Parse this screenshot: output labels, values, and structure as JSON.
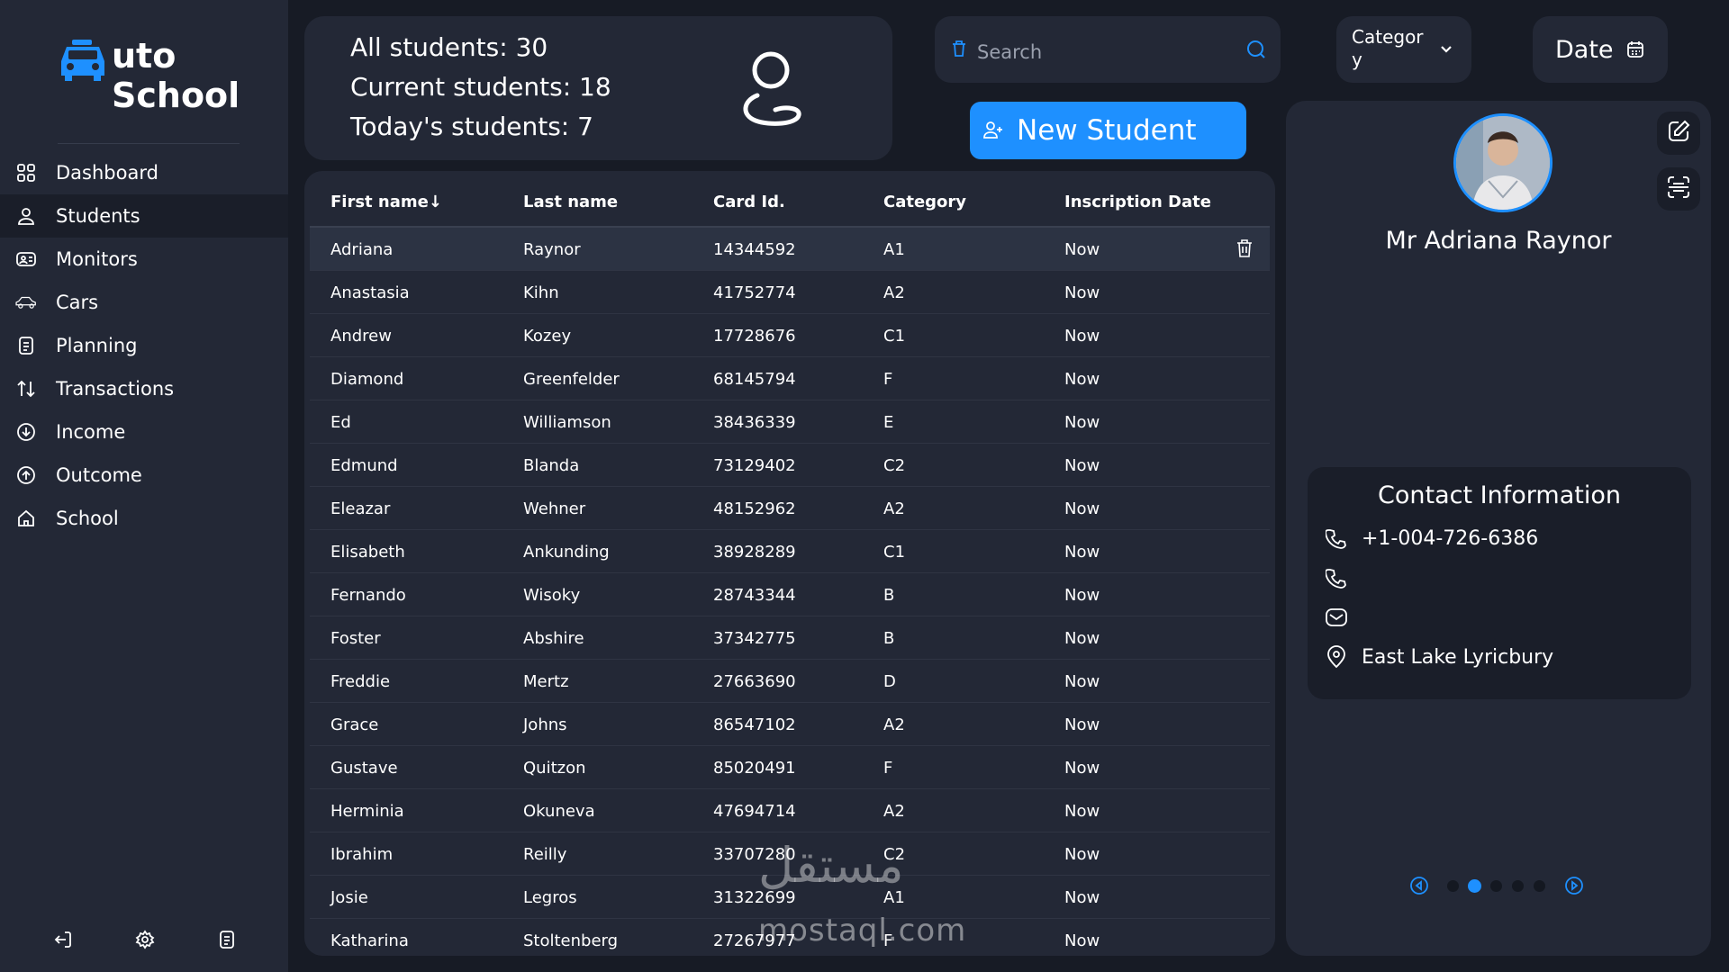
{
  "brand": {
    "line1": "uto",
    "line2": "School",
    "accent": "#1e90ff"
  },
  "sidebar": {
    "items": [
      {
        "label": "Dashboard",
        "icon": "grid-icon"
      },
      {
        "label": "Students",
        "icon": "user-icon",
        "active": true
      },
      {
        "label": "Monitors",
        "icon": "monitor-id-icon"
      },
      {
        "label": "Cars",
        "icon": "car-icon"
      },
      {
        "label": "Planning",
        "icon": "planning-icon"
      },
      {
        "label": "Transactions",
        "icon": "transactions-icon"
      },
      {
        "label": "Income",
        "icon": "income-icon"
      },
      {
        "label": "Outcome",
        "icon": "outcome-icon"
      },
      {
        "label": "School",
        "icon": "home-icon"
      }
    ],
    "bottom": [
      "logout-icon",
      "settings-icon",
      "notes-icon"
    ]
  },
  "stats": {
    "all": "All students: 30",
    "current": "Current students: 18",
    "today": "Today's students: 7"
  },
  "search": {
    "placeholder": "Search"
  },
  "filters": {
    "category": "Category",
    "date": "Date"
  },
  "actions": {
    "new_student": "New Student"
  },
  "table": {
    "headers": [
      "First name",
      "Last name",
      "Card Id.",
      "Category",
      "Inscription Date"
    ],
    "sort_indicator": "↓",
    "rows": [
      [
        "Adriana",
        "Raynor",
        "14344592",
        "A1",
        "Now"
      ],
      [
        "Anastasia",
        "Kihn",
        "41752774",
        "A2",
        "Now"
      ],
      [
        "Andrew",
        "Kozey",
        "17728676",
        "C1",
        "Now"
      ],
      [
        "Diamond",
        "Greenfelder",
        "68145794",
        "F",
        "Now"
      ],
      [
        "Ed",
        "Williamson",
        "38436339",
        "E",
        "Now"
      ],
      [
        "Edmund",
        "Blanda",
        "73129402",
        "C2",
        "Now"
      ],
      [
        "Eleazar",
        "Wehner",
        "48152962",
        "A2",
        "Now"
      ],
      [
        "Elisabeth",
        "Ankunding",
        "38928289",
        "C1",
        "Now"
      ],
      [
        "Fernando",
        "Wisoky",
        "28743344",
        "B",
        "Now"
      ],
      [
        "Foster",
        "Abshire",
        "37342775",
        "B",
        "Now"
      ],
      [
        "Freddie",
        "Mertz",
        "27663690",
        "D",
        "Now"
      ],
      [
        "Grace",
        "Johns",
        "86547102",
        "A2",
        "Now"
      ],
      [
        "Gustave",
        "Quitzon",
        "85020491",
        "F",
        "Now"
      ],
      [
        "Herminia",
        "Okuneva",
        "47694714",
        "A2",
        "Now"
      ],
      [
        "Ibrahim",
        "Reilly",
        "33707280",
        "C2",
        "Now"
      ],
      [
        "Josie",
        "Legros",
        "31322699",
        "A1",
        "Now"
      ],
      [
        "Katharina",
        "Stoltenberg",
        "27267977",
        "F",
        "Now"
      ]
    ]
  },
  "profile": {
    "name": "Mr Adriana Raynor",
    "contact_title": "Contact Information",
    "phone1": "+1-004-726-6386",
    "phone2": "",
    "email": "",
    "address": "East Lake Lyricbury",
    "pager": {
      "pages": 5,
      "current": 2
    }
  },
  "watermark": {
    "arabic": "مستقل",
    "latin": "mostaql.com"
  }
}
